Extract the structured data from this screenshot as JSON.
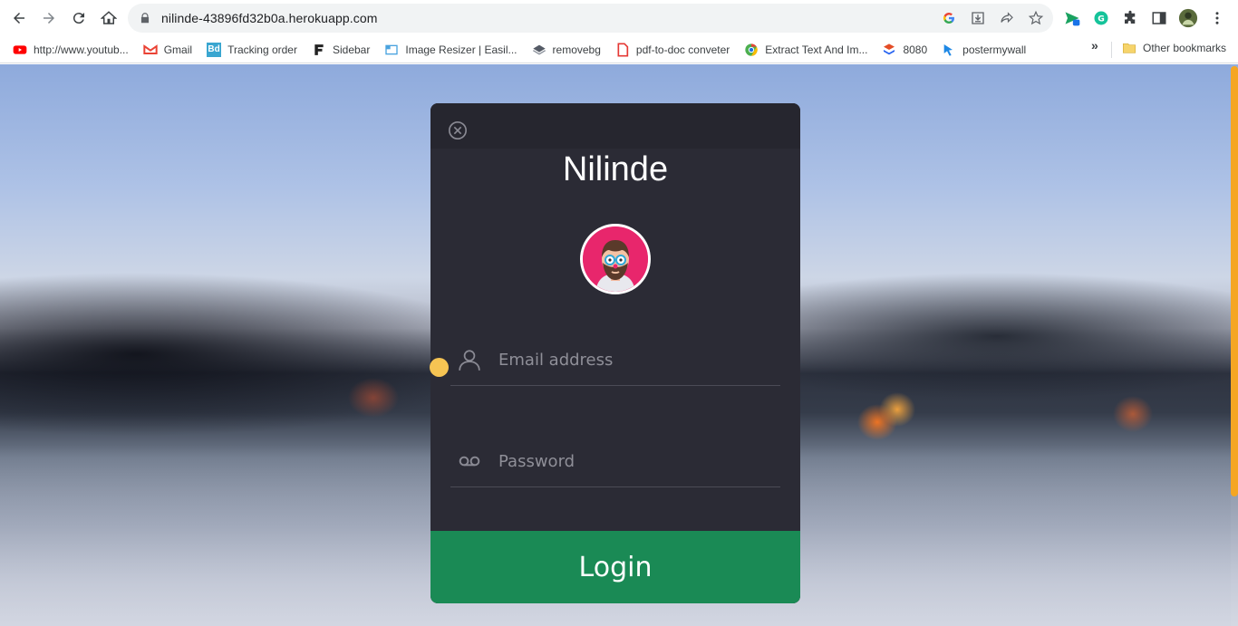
{
  "browser": {
    "url": "nilinde-43896fd32b0a.herokuapp.com",
    "bookmarks": [
      {
        "label": "http://www.youtub...",
        "icon": "youtube-icon",
        "color": "#ff0000"
      },
      {
        "label": "Gmail",
        "icon": "gmail-icon",
        "color": "#ea4335"
      },
      {
        "label": "Tracking order",
        "icon": "bd-icon",
        "color": "#3aa6d0"
      },
      {
        "label": "Sidebar",
        "icon": "f-icon",
        "color": "#222222"
      },
      {
        "label": "Image Resizer | Easil...",
        "icon": "image-resizer-icon",
        "color": "#4aa3df"
      },
      {
        "label": "removebg",
        "icon": "removebg-icon",
        "color": "#555b66"
      },
      {
        "label": "pdf-to-doc conveter",
        "icon": "pdf-icon",
        "color": "#e53935"
      },
      {
        "label": "Extract Text And Im...",
        "icon": "chrome-icon",
        "color": "#4caf50"
      },
      {
        "label": "8080",
        "icon": "stack-icon",
        "color": "#e44d26"
      },
      {
        "label": "postermywall",
        "icon": "postermywall-icon",
        "color": "#1e88e5"
      }
    ],
    "more_label": "»",
    "other_bookmarks": "Other bookmarks"
  },
  "modal": {
    "title": "Nilinde",
    "email_placeholder": "Email address",
    "password_placeholder": "Password",
    "login_label": "Login"
  },
  "colors": {
    "accent_green": "#1a8a55",
    "modal_bg": "#2b2b35",
    "scroll_thumb": "#f5a623",
    "avatar_bg": "#e8266c"
  }
}
